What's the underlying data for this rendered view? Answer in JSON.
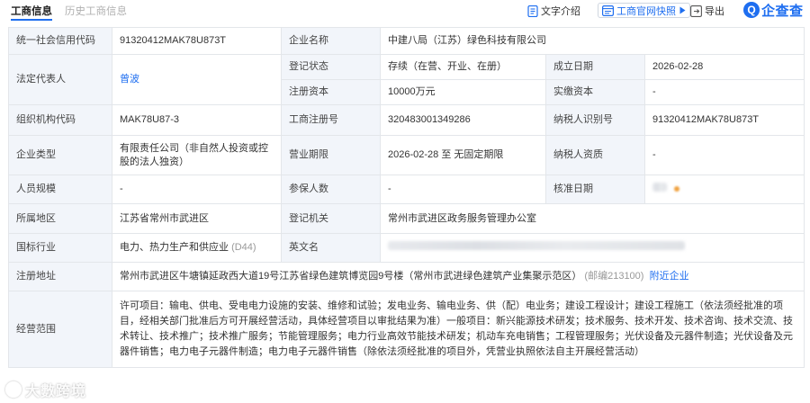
{
  "tabs": [
    {
      "label": "工商信息",
      "active": true
    },
    {
      "label": "历史工商信息",
      "active": false
    }
  ],
  "toolbar": {
    "text_intro": "文字介绍",
    "official_snapshot": "工商官网快照",
    "export": "导出",
    "brand": "企查查",
    "brand_logo_char": "Q"
  },
  "colors": {
    "accent": "#1e6ef0",
    "label_bg": "#f2f5fa",
    "border": "#e3e6ea"
  },
  "icons": [
    "text-doc-icon",
    "official-snapshot-icon",
    "play-arrow-icon",
    "export-icon",
    "qichacha-logo-icon"
  ],
  "info": {
    "credit_code_label": "统一社会信用代码",
    "credit_code": "91320412MAK78U873T",
    "company_name_label": "企业名称",
    "company_name": "中建八局（江苏）绿色科技有限公司",
    "legal_rep_label": "法定代表人",
    "legal_rep": "曾波",
    "status_label": "登记状态",
    "status": "存续（在营、开业、在册）",
    "founded_label": "成立日期",
    "founded": "2026-02-28",
    "reg_capital_label": "注册资本",
    "reg_capital": "10000万元",
    "paid_capital_label": "实缴资本",
    "paid_capital": "-",
    "org_code_label": "组织机构代码",
    "org_code": "MAK78U87-3",
    "reg_no_label": "工商注册号",
    "reg_no": "320483001349286",
    "taxpayer_id_label": "纳税人识别号",
    "taxpayer_id": "91320412MAK78U873T",
    "company_type_label": "企业类型",
    "company_type": "有限责任公司（非自然人投资或控股的法人独资）",
    "business_term_label": "营业期限",
    "business_term": "2026-02-28 至 无固定期限",
    "taxpayer_qual_label": "纳税人资质",
    "taxpayer_qual": "-",
    "staff_size_label": "人员规模",
    "staff_size": "-",
    "insured_label": "参保人数",
    "insured": "-",
    "approval_date_label": "核准日期",
    "region_label": "所属地区",
    "region": "江苏省常州市武进区",
    "reg_authority_label": "登记机关",
    "reg_authority": "常州市武进区政务服务管理办公室",
    "industry_label": "国标行业",
    "industry": "电力、热力生产和供应业",
    "industry_code": "(D44)",
    "english_name_label": "英文名",
    "address_label": "注册地址",
    "address": "常州市武进区牛塘镇延政西大道19号江苏省绿色建筑博览园9号楼（常州市武进绿色建筑产业集聚示范区）",
    "postcode": "(邮编213100)",
    "nearby": "附近企业",
    "scope_label": "经营范围",
    "scope": "许可项目：输电、供电、受电电力设施的安装、维修和试验；发电业务、输电业务、供（配）电业务；建设工程设计；建设工程施工（依法须经批准的项目，经相关部门批准后方可开展经营活动，具体经营项目以审批结果为准）一般项目：新兴能源技术研发；技术服务、技术开发、技术咨询、技术交流、技术转让、技术推广；技术推广服务；节能管理服务；电力行业高效节能技术研发；机动车充电销售；工程管理服务；光伏设备及元器件制造；光伏设备及元器件销售；电力电子元器件制造；电力电子元器件销售（除依法须经批准的项目外，凭营业执照依法自主开展经营活动）"
  },
  "watermark": "大數跨境"
}
